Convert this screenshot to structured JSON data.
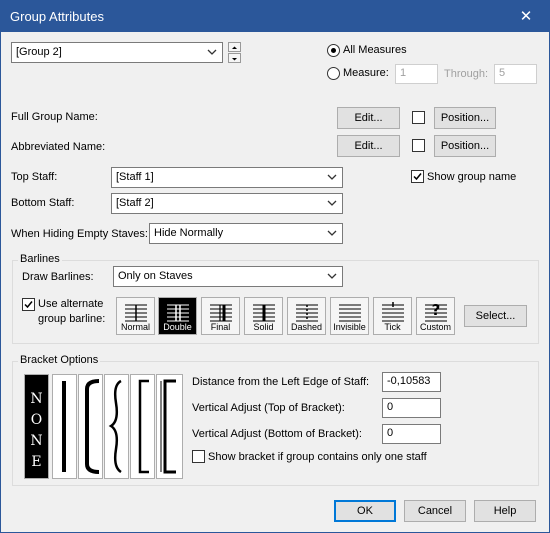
{
  "window": {
    "title": "Group Attributes",
    "close_glyph": "✕"
  },
  "group_select": {
    "value": "[Group 2]"
  },
  "measures": {
    "all_label": "All Measures",
    "measure_label": "Measure:",
    "measure_value": "1",
    "through_label": "Through:",
    "through_value": "5"
  },
  "full_group_name": {
    "label": "Full Group Name:",
    "edit": "Edit...",
    "position": "Position..."
  },
  "abbreviated_name": {
    "label": "Abbreviated Name:",
    "edit": "Edit...",
    "position": "Position..."
  },
  "top_staff": {
    "label": "Top Staff:",
    "value": "[Staff 1]"
  },
  "bottom_staff": {
    "label": "Bottom Staff:",
    "value": "[Staff 2]"
  },
  "show_group_name": {
    "label": "Show group name",
    "checked": true
  },
  "hiding": {
    "label": "When Hiding Empty Staves:",
    "value": "Hide Normally"
  },
  "barlines": {
    "title": "Barlines",
    "draw_label": "Draw Barlines:",
    "draw_value": "Only on Staves",
    "alt_label_1": "Use alternate",
    "alt_label_2": "group barline:",
    "alt_checked": true,
    "types": [
      "Normal",
      "Double",
      "Final",
      "Solid",
      "Dashed",
      "Invisible",
      "Tick",
      "Custom"
    ],
    "selected": "Double",
    "select_button": "Select..."
  },
  "bracket": {
    "title": "Bracket Options",
    "none_letters": [
      "N",
      "O",
      "N",
      "E"
    ],
    "distance_label": "Distance from the Left Edge of Staff:",
    "distance_value": "-0,10583",
    "vtop_label": "Vertical Adjust (Top of Bracket):",
    "vtop_value": "0",
    "vbottom_label": "Vertical Adjust (Bottom of Bracket):",
    "vbottom_value": "0",
    "single_label": "Show bracket if group contains only one staff"
  },
  "footer": {
    "ok": "OK",
    "cancel": "Cancel",
    "help": "Help"
  }
}
